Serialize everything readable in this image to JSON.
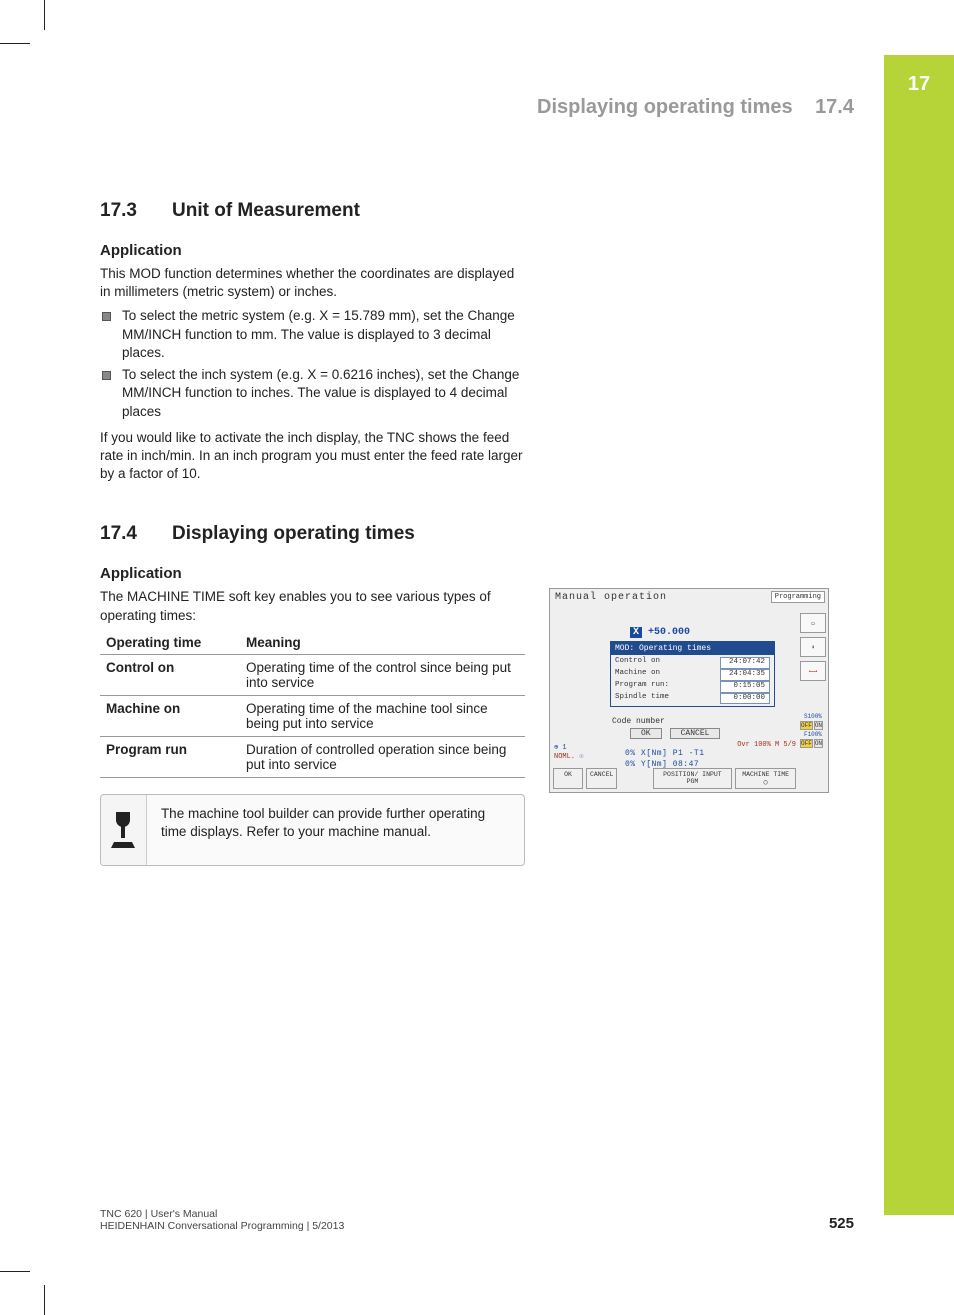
{
  "chapter_number": "17",
  "page_header": {
    "title": "Displaying operating times",
    "num": "17.4"
  },
  "s173": {
    "num": "17.3",
    "title": "Unit of Measurement",
    "sub": "Application",
    "p1": "This MOD function determines whether the coordinates are displayed in millimeters (metric system) or inches.",
    "b1": "To select the metric system (e.g. X = 15.789 mm), set the Change MM/INCH function to mm. The value is displayed to 3 decimal places.",
    "b2": "To select the inch system (e.g. X = 0.6216 inches), set the Change MM/INCH function to inches. The value is displayed to 4 decimal places",
    "p2": "If you would like to activate the inch display, the TNC shows the feed rate in inch/min. In an inch program you must enter the feed rate larger by a factor of 10."
  },
  "s174": {
    "num": "17.4",
    "title": "Displaying operating times",
    "sub": "Application",
    "p1": "The MACHINE TIME soft key enables you to see various types of operating times:",
    "table": {
      "h1": "Operating time",
      "h2": "Meaning",
      "rows": [
        {
          "k": "Control on",
          "v": "Operating time of the control since being put into service"
        },
        {
          "k": "Machine on",
          "v": "Operating time of the machine tool since being put into service"
        },
        {
          "k": "Program run",
          "v": "Duration of controlled operation since being put into service"
        }
      ]
    },
    "note": "The machine tool builder can provide further operating time displays. Refer to your machine manual."
  },
  "screenshot": {
    "mode": "Manual operation",
    "prog_btn": "Programming",
    "coord_label": "X",
    "coord_val": "+50.000",
    "dialog_title": "MOD: Operating times",
    "rows": {
      "r1k": "Control on",
      "r1v": "24:07:42",
      "r2k": "Machine on",
      "r2v": "24:04:35",
      "r3k": "Program run:",
      "r3v": "0:15:05",
      "r4k": "Spindle time",
      "r4v": "0:00:00"
    },
    "code_label": "Code number",
    "ok": "OK",
    "cancel": "CANCEL",
    "noml": "NOML.",
    "status_right": "Ovr 100%  M 5/9",
    "axis1": "0% X[Nm] P1  -T1",
    "axis2": "0% Y[Nm] 08:47",
    "s100": "S100%",
    "f100": "F100%",
    "off": "OFF",
    "on": "ON",
    "btn_ok": "OK",
    "btn_cancel": "CANCEL",
    "btn_pos": "POSITION/ INPUT PGM",
    "btn_mtime": "MACHINE TIME"
  },
  "footer": {
    "line1": "TNC 620 | User's Manual",
    "line2": "HEIDENHAIN Conversational Programming | 5/2013",
    "page": "525"
  }
}
